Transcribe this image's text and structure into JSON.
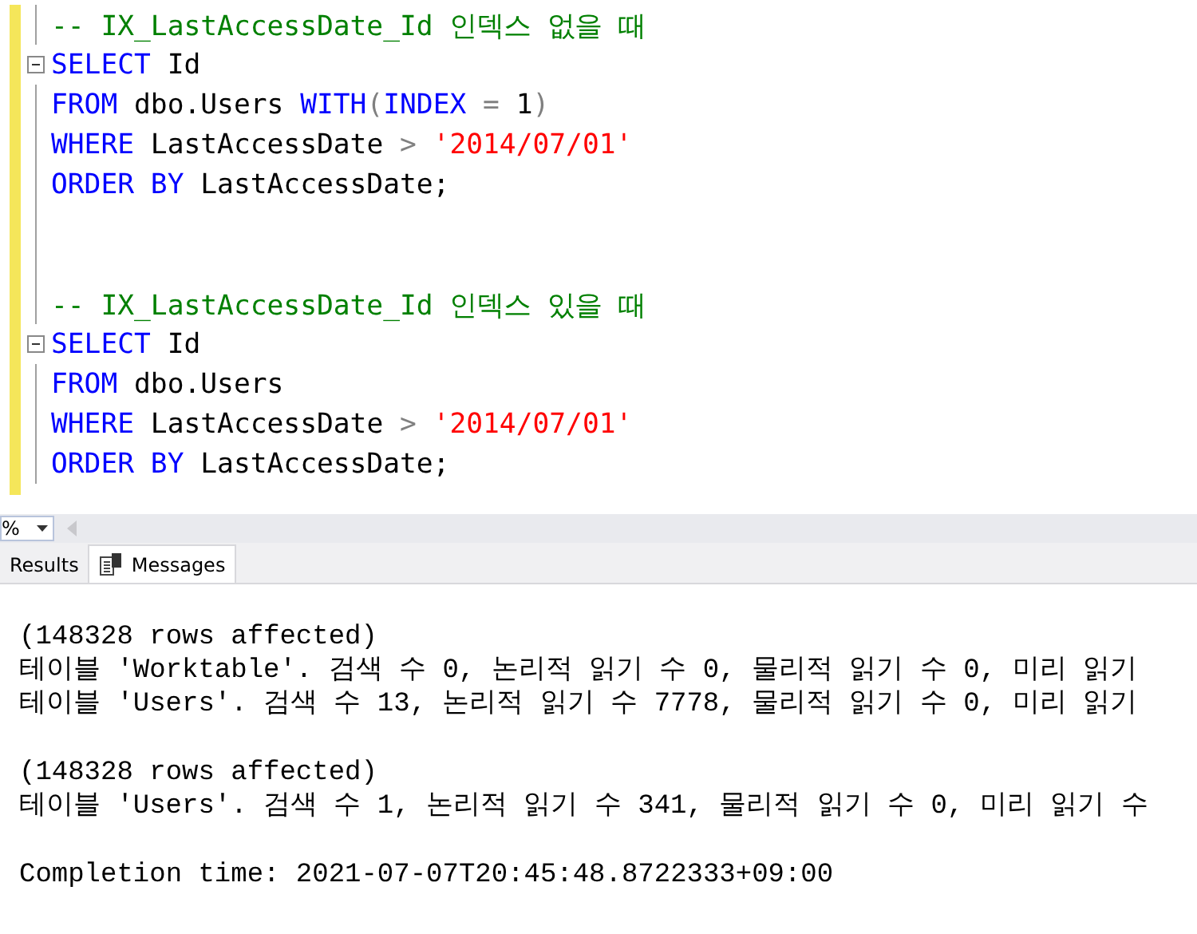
{
  "editor": {
    "lines": [
      {
        "fold": false,
        "tokens": [
          {
            "kind": "comment",
            "text": "-- IX_LastAccessDate_Id 인덱스 없을 때"
          }
        ]
      },
      {
        "fold": true,
        "tokens": [
          {
            "kind": "keyword",
            "text": "SELECT"
          },
          {
            "kind": "plain",
            "text": " Id"
          }
        ]
      },
      {
        "fold": false,
        "tokens": [
          {
            "kind": "keyword",
            "text": "FROM"
          },
          {
            "kind": "plain",
            "text": " dbo.Users "
          },
          {
            "kind": "keyword",
            "text": "WITH"
          },
          {
            "kind": "operator",
            "text": "("
          },
          {
            "kind": "keyword",
            "text": "INDEX"
          },
          {
            "kind": "operator",
            "text": " = "
          },
          {
            "kind": "plain",
            "text": "1"
          },
          {
            "kind": "operator",
            "text": ")"
          }
        ]
      },
      {
        "fold": false,
        "tokens": [
          {
            "kind": "keyword",
            "text": "WHERE"
          },
          {
            "kind": "plain",
            "text": " LastAccessDate "
          },
          {
            "kind": "operator",
            "text": ">"
          },
          {
            "kind": "string",
            "text": " '2014/07/01'"
          }
        ]
      },
      {
        "fold": false,
        "tokens": [
          {
            "kind": "keyword",
            "text": "ORDER BY"
          },
          {
            "kind": "plain",
            "text": " LastAccessDate;"
          }
        ]
      },
      {
        "fold": false
      },
      {
        "fold": false
      },
      {
        "fold": false,
        "tokens": [
          {
            "kind": "comment",
            "text": "-- IX_LastAccessDate_Id 인덱스 있을 때"
          }
        ]
      },
      {
        "fold": true,
        "tokens": [
          {
            "kind": "keyword",
            "text": "SELECT"
          },
          {
            "kind": "plain",
            "text": " Id"
          }
        ]
      },
      {
        "fold": false,
        "tokens": [
          {
            "kind": "keyword",
            "text": "FROM"
          },
          {
            "kind": "plain",
            "text": " dbo.Users"
          }
        ]
      },
      {
        "fold": false,
        "tokens": [
          {
            "kind": "keyword",
            "text": "WHERE"
          },
          {
            "kind": "plain",
            "text": " LastAccessDate "
          },
          {
            "kind": "operator",
            "text": ">"
          },
          {
            "kind": "string",
            "text": " '2014/07/01'"
          }
        ]
      },
      {
        "fold": false,
        "tokens": [
          {
            "kind": "keyword",
            "text": "ORDER BY"
          },
          {
            "kind": "plain",
            "text": " LastAccessDate;"
          }
        ]
      }
    ]
  },
  "zoom": {
    "value": "%"
  },
  "tabs": [
    {
      "label": "Results",
      "selected": false
    },
    {
      "label": "Messages",
      "selected": true
    }
  ],
  "messages": [
    [
      "(148328 rows affected)",
      "테이블 'Worktable'. 검색 수 0, 논리적 읽기 수 0, 물리적 읽기 수 0, 미리 읽기",
      "테이블 'Users'. 검색 수 13, 논리적 읽기 수 7778, 물리적 읽기 수 0, 미리 읽기"
    ],
    [
      "(148328 rows affected)",
      "테이블 'Users'. 검색 수 1, 논리적 읽기 수 341, 물리적 읽기 수 0, 미리 읽기 수"
    ],
    [
      "Completion time: 2021-07-07T20:45:48.8722333+09:00"
    ]
  ]
}
